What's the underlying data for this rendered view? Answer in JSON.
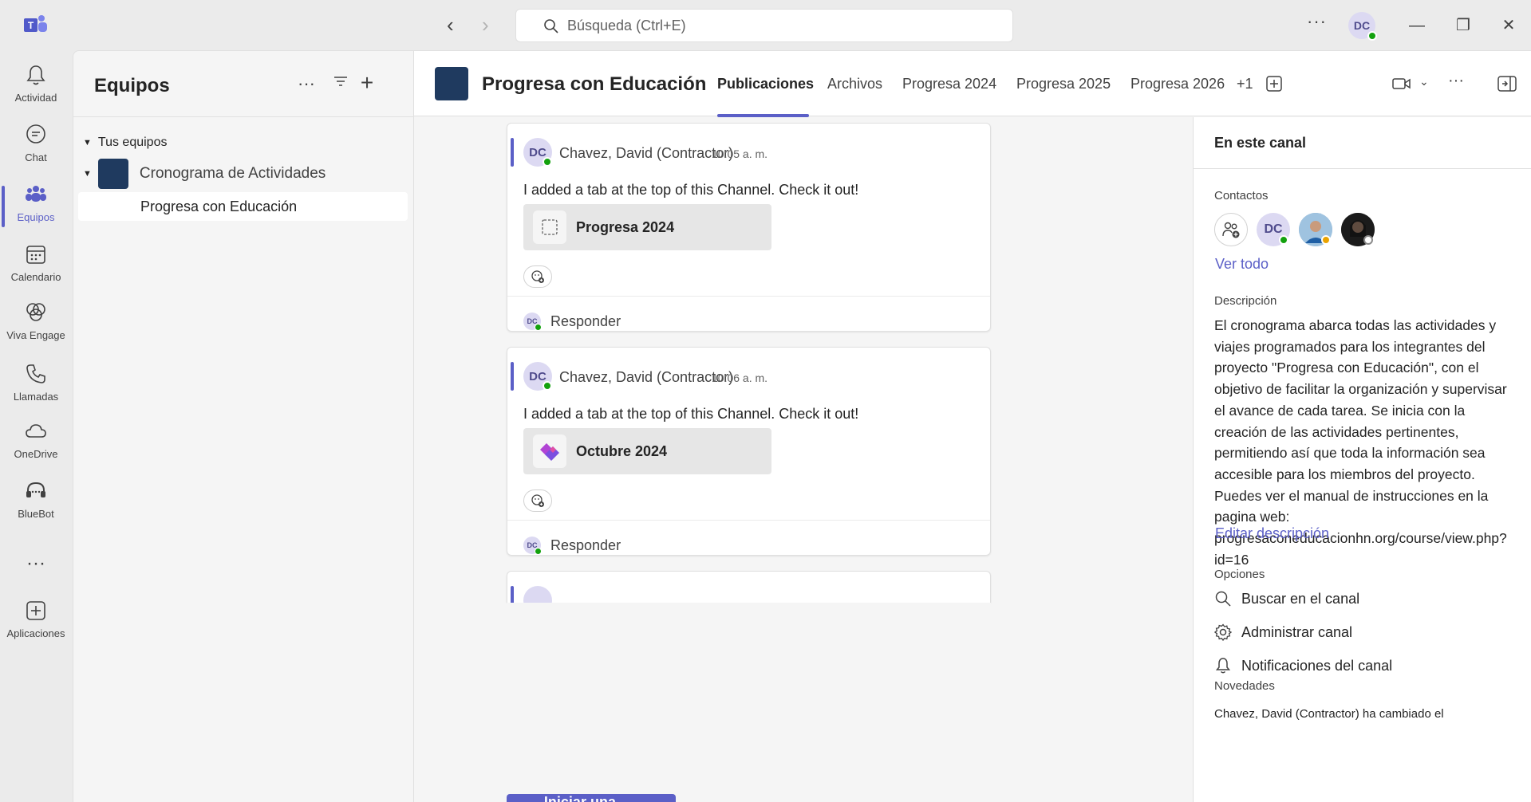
{
  "search": {
    "placeholder": "Búsqueda (Ctrl+E)"
  },
  "user": {
    "initials": "DC"
  },
  "rail": [
    {
      "label": "Actividad",
      "icon": "bell-icon"
    },
    {
      "label": "Chat",
      "icon": "chat-icon"
    },
    {
      "label": "Equipos",
      "icon": "teams-icon"
    },
    {
      "label": "Calendario",
      "icon": "calendar-icon"
    },
    {
      "label": "Viva Engage",
      "icon": "viva-engage-icon"
    },
    {
      "label": "Llamadas",
      "icon": "phone-icon"
    },
    {
      "label": "OneDrive",
      "icon": "cloud-icon"
    },
    {
      "label": "BlueBot",
      "icon": "headset-icon"
    },
    {
      "label": "Aplicaciones",
      "icon": "add-apps-icon"
    }
  ],
  "teams_panel": {
    "title": "Equipos",
    "section": "Tus equipos",
    "team": "Cronograma de Actividades",
    "channel": "Progresa con Educación"
  },
  "channel": {
    "title": "Progresa con Educación",
    "tabs": [
      "Publicaciones",
      "Archivos",
      "Progresa 2024",
      "Progresa 2025",
      "Progresa 2026",
      "+1"
    ]
  },
  "posts": [
    {
      "initials": "DC",
      "author": "Chavez, David (Contractor)",
      "time": "10:05 a. m.",
      "text": "I added a tab at the top of this Channel. Check it out!",
      "card": "Progresa 2024",
      "card_icon": "placeholder-icon",
      "reply": "Responder"
    },
    {
      "initials": "DC",
      "author": "Chavez, David (Contractor)",
      "time": "10:06 a. m.",
      "text": "I added a tab at the top of this Channel. Check it out!",
      "card": "Octubre 2024",
      "card_icon": "planner-icon",
      "reply": "Responder"
    }
  ],
  "new_post": "Iniciar una publicación",
  "info": {
    "title": "En este canal",
    "contacts_label": "Contactos",
    "see_all": "Ver todo",
    "description_label": "Descripción",
    "description": "El cronograma abarca todas las actividades y viajes programados para los integrantes del proyecto \"Progresa con Educación\", con el objetivo de facilitar la organización y supervisar el avance de cada tarea. Se inicia con la creación de las actividades pertinentes, permitiendo así que toda la información sea accesible para los miembros del proyecto. Puedes ver el manual de instrucciones en la pagina web: progresaconeducacionhn.org/course/view.php?id=16",
    "edit_description": "Editar descripción",
    "options_label": "Opciones",
    "options": [
      "Buscar en el canal",
      "Administrar canal",
      "Notificaciones del canal"
    ],
    "news_label": "Novedades",
    "news_text": "Chavez, David (Contractor) ha cambiado el"
  },
  "colors": {
    "accent": "#5b5fc7",
    "presence_available": "#13a10e",
    "presence_away": "#eaa300"
  }
}
